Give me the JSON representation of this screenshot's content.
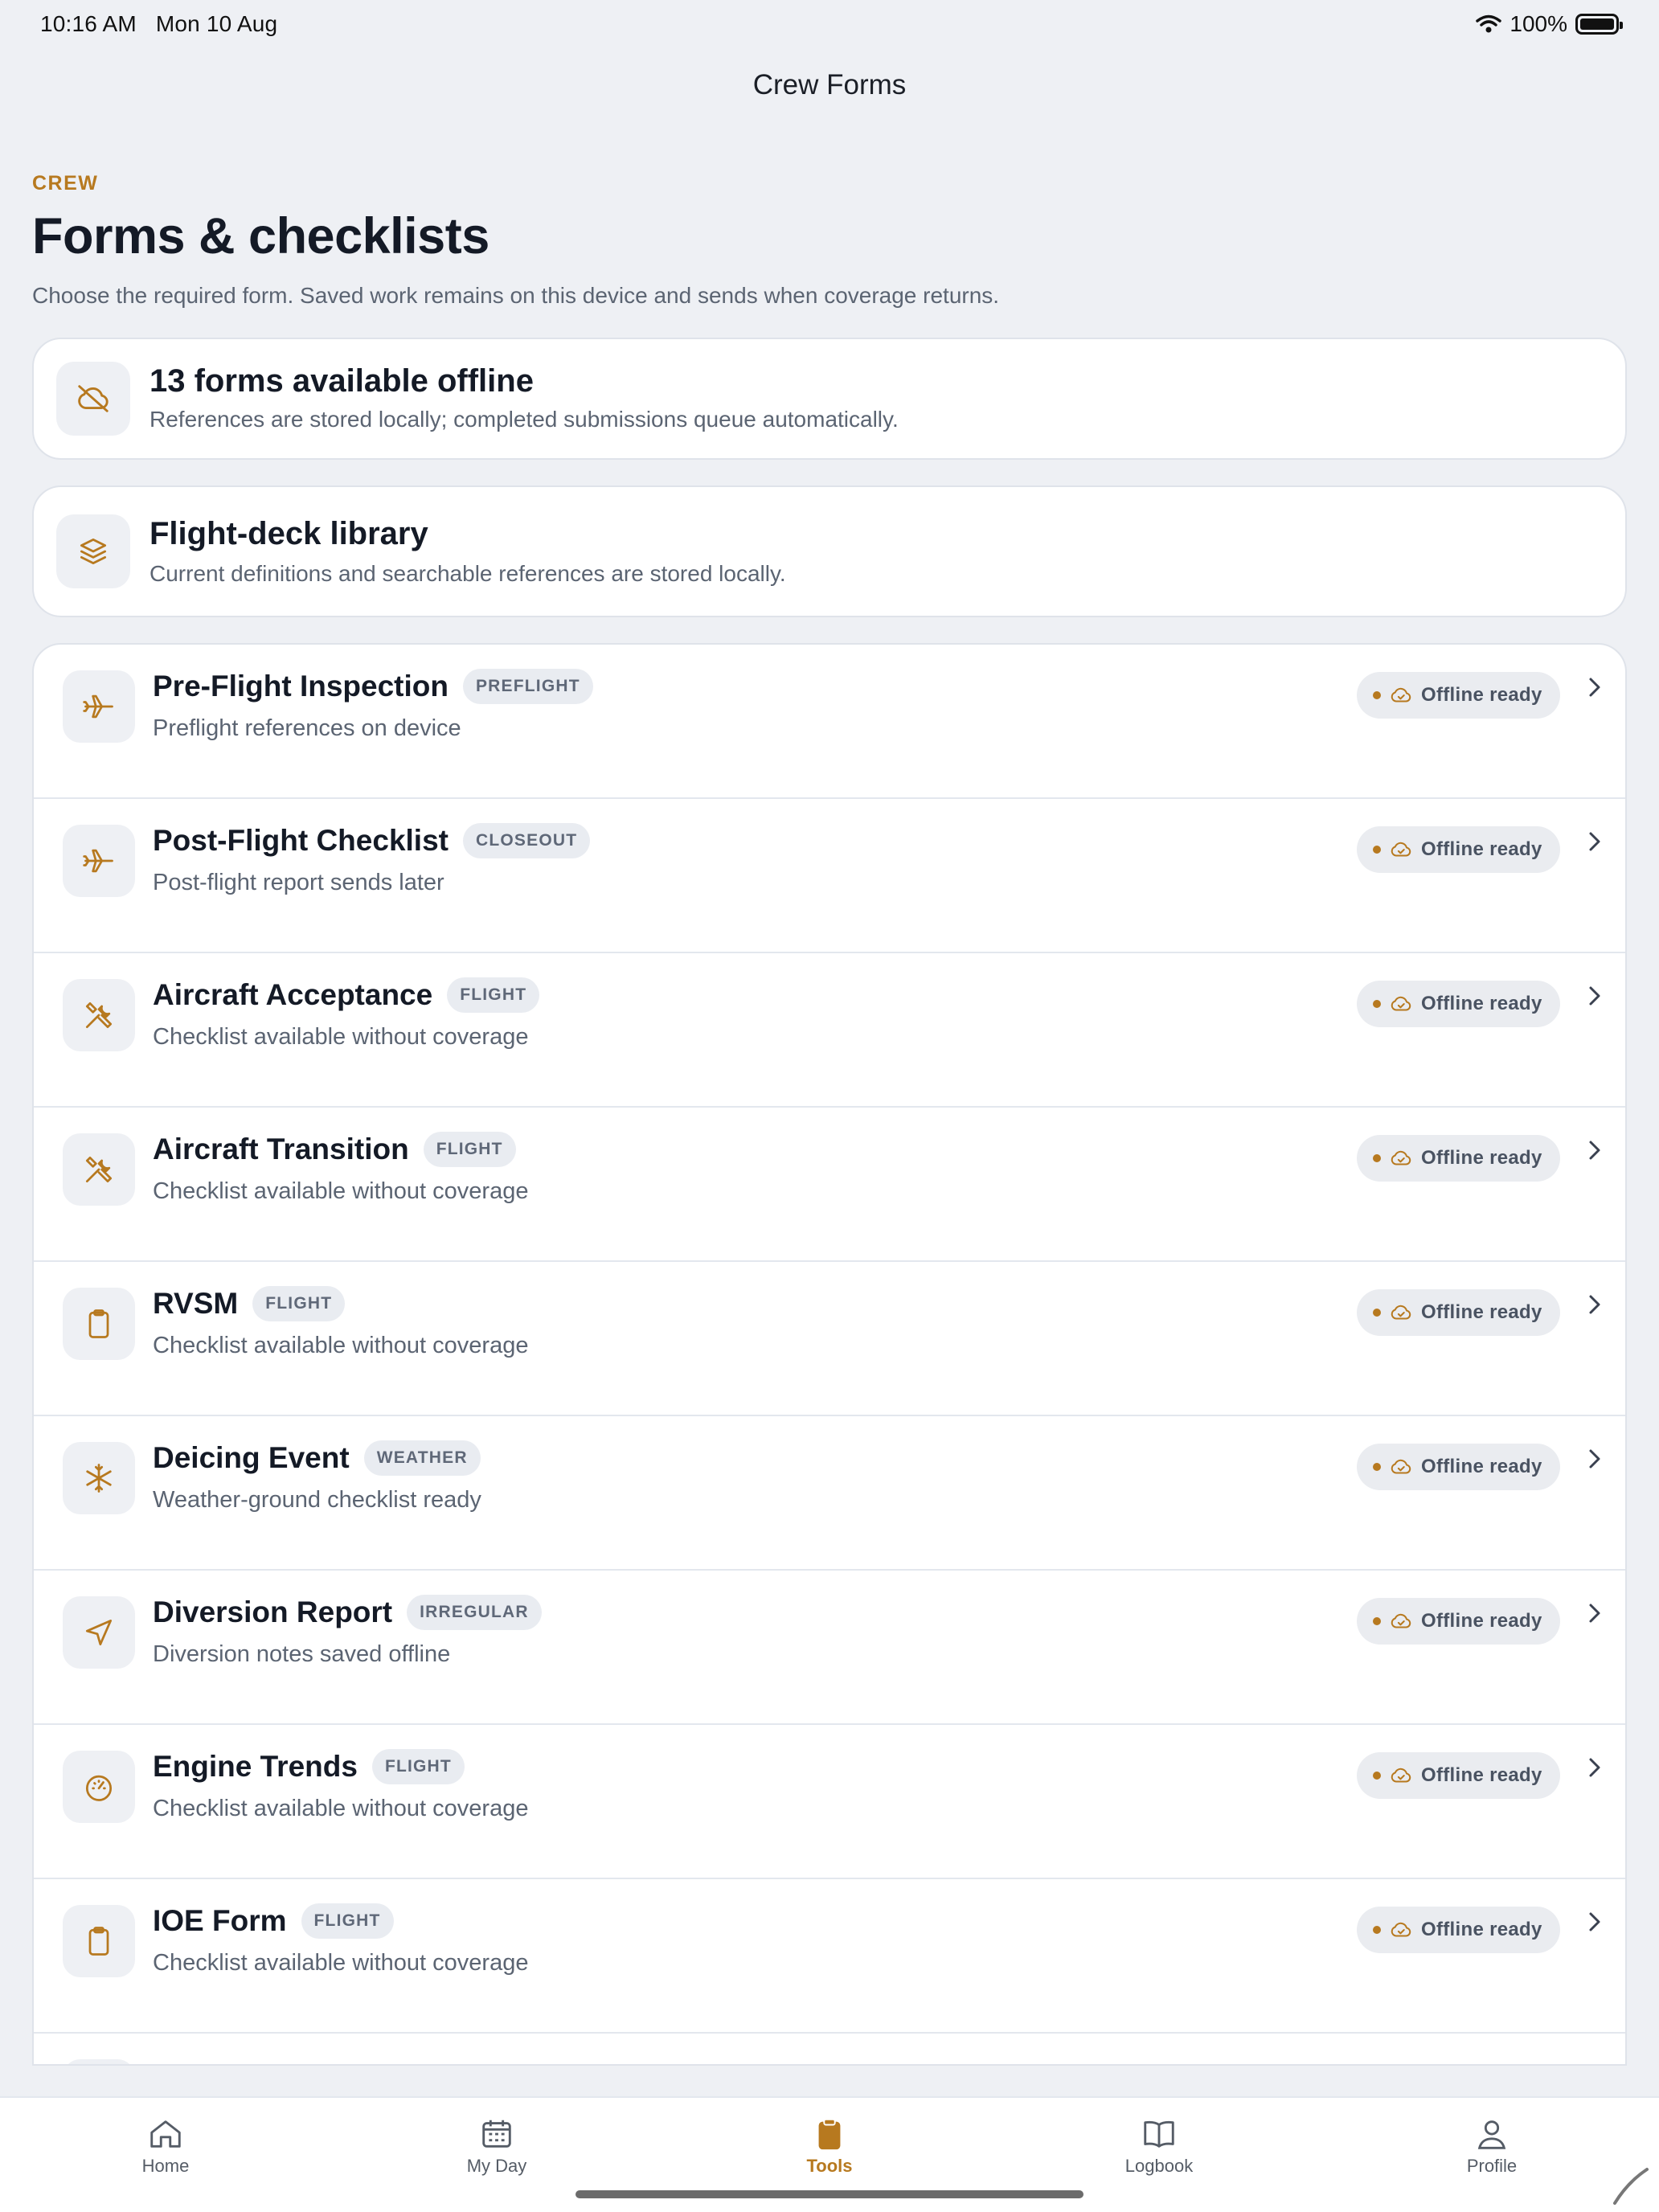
{
  "status_bar": {
    "time": "10:16 AM",
    "date": "Mon 10 Aug",
    "battery": "100%"
  },
  "nav": {
    "title": "Crew Forms"
  },
  "header": {
    "eyebrow": "CREW",
    "title": "Forms & checklists",
    "subtitle": "Choose the required form. Saved work remains on this device and sends when coverage returns."
  },
  "offline_card": {
    "icon": "cloud-off-icon",
    "title": "13 forms available offline",
    "subtitle": "References are stored locally; completed submissions queue automatically."
  },
  "library_card": {
    "icon": "layers-icon",
    "title": "Flight-deck library",
    "subtitle": "Current definitions and searchable references are stored locally."
  },
  "forms": [
    {
      "title": "Pre-Flight Inspection",
      "badge": "PREFLIGHT",
      "subtitle": "Preflight references on device",
      "status": "Offline ready",
      "icon": "plane-icon"
    },
    {
      "title": "Post-Flight Checklist",
      "badge": "CLOSEOUT",
      "subtitle": "Post-flight report sends later",
      "status": "Offline ready",
      "icon": "plane-icon"
    },
    {
      "title": "Aircraft Acceptance",
      "badge": "FLIGHT",
      "subtitle": "Checklist available without coverage",
      "status": "Offline ready",
      "icon": "tools-icon"
    },
    {
      "title": "Aircraft Transition",
      "badge": "FLIGHT",
      "subtitle": "Checklist available without coverage",
      "status": "Offline ready",
      "icon": "tools-icon"
    },
    {
      "title": "RVSM",
      "badge": "FLIGHT",
      "subtitle": "Checklist available without coverage",
      "status": "Offline ready",
      "icon": "clipboard-icon"
    },
    {
      "title": "Deicing Event",
      "badge": "WEATHER",
      "subtitle": "Weather-ground checklist ready",
      "status": "Offline ready",
      "icon": "snowflake-icon"
    },
    {
      "title": "Diversion Report",
      "badge": "IRREGULAR",
      "subtitle": "Diversion notes saved offline",
      "status": "Offline ready",
      "icon": "navigation-icon"
    },
    {
      "title": "Engine Trends",
      "badge": "FLIGHT",
      "subtitle": "Checklist available without coverage",
      "status": "Offline ready",
      "icon": "gauge-icon"
    },
    {
      "title": "IOE Form",
      "badge": "FLIGHT",
      "subtitle": "Checklist available without coverage",
      "status": "Offline ready",
      "icon": "clipboard-icon"
    }
  ],
  "tabs": [
    {
      "label": "Home",
      "icon": "home-icon",
      "active": false
    },
    {
      "label": "My Day",
      "icon": "calendar-icon",
      "active": false
    },
    {
      "label": "Tools",
      "icon": "clipboard-icon",
      "active": true
    },
    {
      "label": "Logbook",
      "icon": "book-icon",
      "active": false
    },
    {
      "label": "Profile",
      "icon": "user-icon",
      "active": false
    }
  ],
  "colors": {
    "accent": "#b7791f",
    "background": "#eef0f4",
    "card": "#ffffff",
    "text": "#141a26",
    "muted": "#5b6472"
  }
}
